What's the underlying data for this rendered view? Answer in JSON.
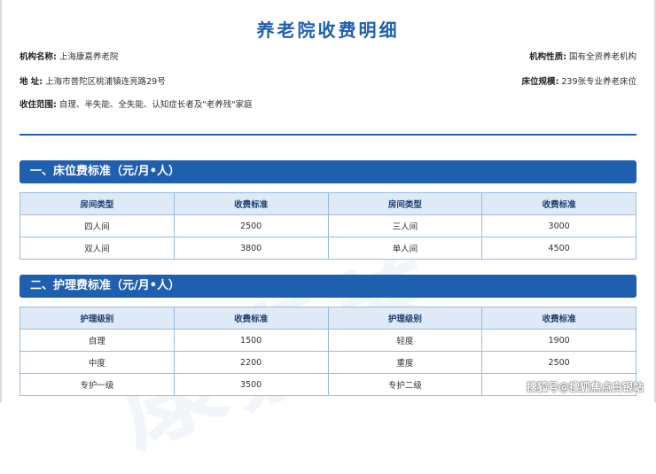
{
  "doc": {
    "title": "养老院收费明细",
    "info": {
      "org_name_label": "机构名称:",
      "org_name": "上海康嘉养老院",
      "nature_label": "机构性质:",
      "nature": "国有全资养老机构",
      "address_label": "地 址:",
      "address": "上海市普陀区桃浦镇连亮路29号",
      "beds_label": "床位规模:",
      "beds": "239张专业养老床位",
      "scope_label": "收住范围:",
      "scope": "自理、半失能、全失能、认知症长者及\"老养残\"家庭"
    },
    "section1": {
      "title": "一、床位费标准（元/月•人）",
      "headers": [
        "房间类型",
        "收费标准",
        "房间类型",
        "收费标准"
      ],
      "rows": [
        [
          "四人间",
          "2500",
          "三人间",
          "3000"
        ],
        [
          "双人间",
          "3800",
          "单人间",
          "4500"
        ]
      ]
    },
    "section2": {
      "title": "二、护理费标准（元/月•人）",
      "headers": [
        "护理级别",
        "收费标准",
        "护理级别",
        "收费标准"
      ],
      "rows": [
        [
          "自理",
          "1500",
          "轻度",
          "1900"
        ],
        [
          "中度",
          "2200",
          "重度",
          "2500"
        ],
        [
          "专护一级",
          "3500",
          "专护二级",
          ""
        ]
      ]
    },
    "credit": "搜狐号@搜狐焦点白银站",
    "watermark": "康嘉养"
  }
}
